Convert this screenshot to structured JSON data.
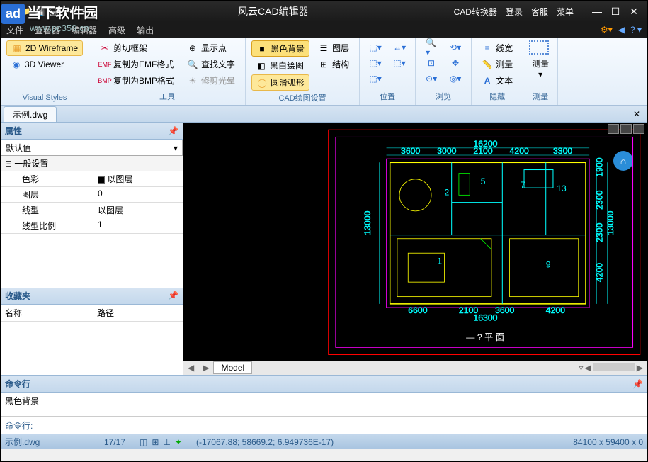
{
  "app": {
    "title": "风云CAD编辑器"
  },
  "titlebar": {
    "right_items": [
      "CAD转换器",
      "登录",
      "客服",
      "菜单"
    ],
    "win": {
      "min": "—",
      "max": "☐",
      "close": "✕"
    }
  },
  "watermark": {
    "logo": "ad",
    "text": "当下软件园",
    "url": "www.pc359.cn"
  },
  "menubar": {
    "items": [
      "文件",
      "查看器",
      "编辑器",
      "高级",
      "输出"
    ]
  },
  "ribbon": {
    "groups": {
      "visual_styles": {
        "label": "Visual Styles",
        "wireframe": "2D Wireframe",
        "viewer": "3D Viewer"
      },
      "tools": {
        "label": "工具",
        "clip_frame": "剪切框架",
        "copy_emf": "复制为EMF格式",
        "copy_bmp": "复制为BMP格式",
        "show_point": "显示点",
        "find_text": "查找文字",
        "trim_halo": "修剪光晕"
      },
      "cad_draw": {
        "label": "CAD绘图设置",
        "black_bg": "黑色背景",
        "bw_draw": "黑白绘图",
        "smooth_arc": "圆滑弧形",
        "layers": "图层",
        "structure": "结构"
      },
      "position": {
        "label": "位置"
      },
      "browse": {
        "label": "浏览"
      },
      "hide": {
        "label": "隐藏",
        "lineweight": "线宽",
        "measure": "测量",
        "text": "文本"
      },
      "measure": {
        "label": "测量"
      }
    }
  },
  "tabs": {
    "active": "示例.dwg"
  },
  "properties": {
    "header": "属性",
    "default": "默认值",
    "general_group": "一般设置",
    "rows": {
      "color": {
        "label": "色彩",
        "value": "以图层"
      },
      "layer": {
        "label": "图层",
        "value": "0"
      },
      "linetype": {
        "label": "线型",
        "value": "以图层"
      },
      "ltscale": {
        "label": "线型比例",
        "value": "1"
      }
    }
  },
  "favorites": {
    "header": "收藏夹",
    "cols": {
      "name": "名称",
      "path": "路径"
    }
  },
  "canvas": {
    "model_tab": "Model",
    "dimensions": {
      "top": [
        "3600",
        "3000",
        "2100",
        "4200",
        "3300"
      ],
      "top_total": "16200",
      "bottom": [
        "6600",
        "2100",
        "3600",
        "4200"
      ],
      "bottom_total": "16300",
      "left_total": "13000",
      "right": [
        "1900",
        "2300",
        "2300",
        "4200"
      ],
      "right_total": "13000",
      "rooms": [
        "1",
        "2",
        "5",
        "7",
        "9",
        "13"
      ]
    },
    "caption": "— ? 平 面"
  },
  "command": {
    "header": "命令行",
    "output": "黑色背景",
    "prompt": "命令行:"
  },
  "statusbar": {
    "file": "示例.dwg",
    "count": "17/17",
    "coords": "(-17067.88; 58669.2; 6.949736E-17)",
    "size": "84100 x 59400 x 0"
  }
}
